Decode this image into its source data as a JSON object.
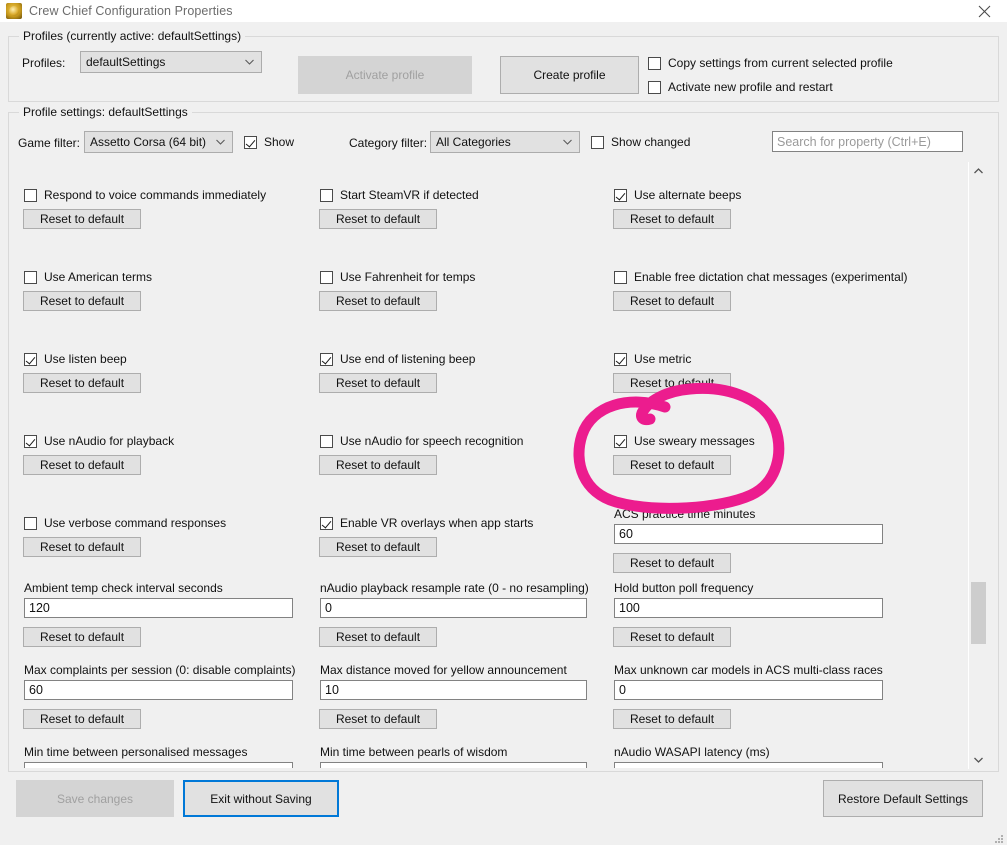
{
  "window": {
    "title": "Crew Chief Configuration Properties",
    "close_icon": "close-icon",
    "app_icon": "crew-chief-logo-icon"
  },
  "profiles_group": {
    "title": "Profiles (currently active: defaultSettings)",
    "profiles_label": "Profiles:",
    "profile_selected": "defaultSettings",
    "activate_profile_button": "Activate profile",
    "create_profile_button": "Create profile",
    "copy_settings_checkbox": {
      "label": "Copy settings from current selected profile",
      "checked": false
    },
    "activate_new_profile_checkbox": {
      "label": "Activate new profile and restart",
      "checked": false
    }
  },
  "settings_group": {
    "title": "Profile settings: defaultSettings",
    "game_filter_label": "Game filter:",
    "game_filter_value": "Assetto Corsa (64 bit)",
    "show_checkbox": {
      "label": "Show",
      "checked": true
    },
    "category_filter_label": "Category filter:",
    "category_filter_value": "All Categories",
    "show_changed_checkbox": {
      "label": "Show changed",
      "checked": false
    },
    "search_placeholder": "Search for property (Ctrl+E)",
    "search_value": ""
  },
  "reset_button_label": "Reset to default",
  "settings": {
    "checkbox_rows": [
      {
        "cells": [
          {
            "label": "Respond to voice commands immediately",
            "checked": false
          },
          {
            "label": "Start SteamVR if detected",
            "checked": false
          },
          {
            "label": "Use alternate beeps",
            "checked": true
          }
        ]
      },
      {
        "cells": [
          {
            "label": "Use American terms",
            "checked": false
          },
          {
            "label": "Use Fahrenheit for temps",
            "checked": false
          },
          {
            "label": "Enable free dictation chat messages (experimental)",
            "checked": false
          }
        ]
      },
      {
        "cells": [
          {
            "label": "Use listen beep",
            "checked": true
          },
          {
            "label": "Use end of listening beep",
            "checked": true
          },
          {
            "label": "Use metric",
            "checked": true
          }
        ]
      },
      {
        "cells": [
          {
            "label": "Use nAudio for playback",
            "checked": true
          },
          {
            "label": "Use nAudio for speech recognition",
            "checked": false
          },
          {
            "label": "Use sweary messages",
            "checked": true
          }
        ]
      }
    ],
    "mixed_row": {
      "cells": [
        {
          "type": "checkbox",
          "label": "Use verbose command responses",
          "checked": false
        },
        {
          "type": "checkbox",
          "label": "Enable VR overlays when app starts",
          "checked": true
        },
        {
          "type": "text",
          "label": "ACS practice time minutes",
          "value": "60"
        }
      ]
    },
    "text_rows": [
      {
        "cells": [
          {
            "label": "Ambient temp check interval seconds",
            "value": "120"
          },
          {
            "label": "nAudio playback resample rate (0 - no resampling)",
            "value": "0"
          },
          {
            "label": "Hold button poll frequency",
            "value": "100"
          }
        ]
      },
      {
        "cells": [
          {
            "label": "Max complaints per session (0: disable complaints)",
            "value": "60"
          },
          {
            "label": "Max distance moved for yellow announcement",
            "value": "10"
          },
          {
            "label": "Max unknown car models in ACS multi-class races",
            "value": "0"
          }
        ]
      }
    ],
    "partial_row": {
      "cells": [
        {
          "label": "Min time between personalised messages"
        },
        {
          "label": "Min time between pearls of wisdom"
        },
        {
          "label": "nAudio WASAPI latency (ms)"
        }
      ]
    }
  },
  "scrollbar": {
    "up_icon": "chevron-up-icon",
    "down_icon": "chevron-down-icon",
    "thumb_name": "scrollbar-thumb"
  },
  "bottom_bar": {
    "save_changes_button": "Save changes",
    "exit_without_saving_button": "Exit without Saving",
    "restore_defaults_button": "Restore Default Settings"
  },
  "annotation": {
    "type": "hand-drawn-circle",
    "color": "#ec1c8e",
    "target": "Use sweary messages"
  }
}
